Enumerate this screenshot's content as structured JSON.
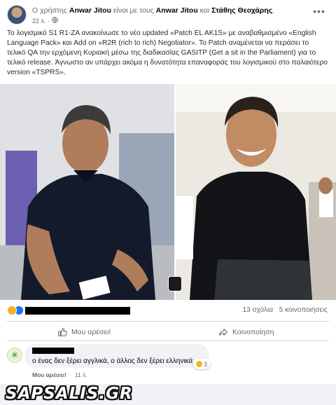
{
  "post": {
    "header_prefix": "Ο χρήστης ",
    "author": "Anwar Jitou",
    "header_middle": " είναι με τους ",
    "tagged_1": "Anwar Jitou",
    "header_and": " και ",
    "tagged_2": "Στάθης Θεοχάρης",
    "header_end": ".",
    "time": "22 λ. · ",
    "audience_icon": "globe-icon",
    "text": "Το λογισμικό S1 R1-ZA ανακοίνωσε το νέο updated «Patch EL AK1S» με αναβαθμισμένο «English Language Pack» και Add on «R2R (rich to rich) Negotiator». Το Patch αναμένεται να περάσει το τελικό QA την ερχόμενη Κυριακή μέσω της διαδικασίας GASITP (Get a sit in the Parliament) για το τελικό release. Άγνωστο αν υπάρχει ακόμα η δυνατότητα επαναφοράς του λογισμικού στο παλαιότερο version «TSPRS»."
  },
  "stats": {
    "comments": "13 σχόλια",
    "shares": "5 κοινοποιήσεις"
  },
  "actions": {
    "like": "Μου αρέσει!",
    "share": "Κοινοποίηση"
  },
  "comment": {
    "text": "ο ένας δεν ξέρει αγγλικά, ο άλλος δεν ξέρει ελληνικά",
    "reaction_count": "3",
    "like": "Μου αρέσει!",
    "time": "11 λ."
  },
  "brand": "SAPSALIS.GR",
  "colors": {
    "accent": "#1877f2",
    "haha": "#f7b125",
    "muted_text": "#65676b"
  }
}
